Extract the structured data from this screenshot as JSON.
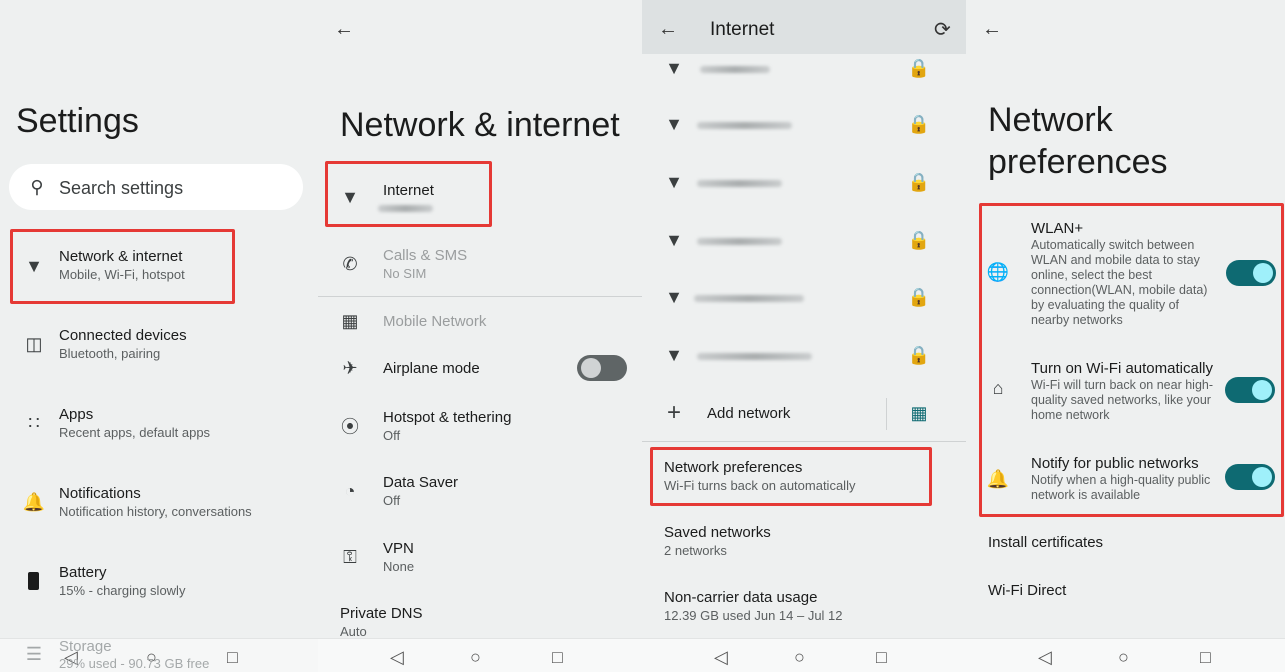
{
  "panel1": {
    "title": "Settings",
    "search_placeholder": "Search settings",
    "items": [
      {
        "label": "Network & internet",
        "sub": "Mobile, Wi-Fi, hotspot",
        "icon": "wifi-icon"
      },
      {
        "label": "Connected devices",
        "sub": "Bluetooth, pairing",
        "icon": "devices-icon"
      },
      {
        "label": "Apps",
        "sub": "Recent apps, default apps",
        "icon": "apps-grid-icon"
      },
      {
        "label": "Notifications",
        "sub": "Notification history, conversations",
        "icon": "bell-icon"
      },
      {
        "label": "Battery",
        "sub": "15% - charging slowly",
        "icon": "battery-icon"
      },
      {
        "label": "Storage",
        "sub": "29% used - 90.73 GB free",
        "icon": "storage-icon"
      }
    ]
  },
  "panel2": {
    "title": "Network & internet",
    "items": [
      {
        "label": "Internet",
        "sub": "",
        "icon": "wifi-icon"
      },
      {
        "label": "Calls & SMS",
        "sub": "No SIM",
        "icon": "calls-icon"
      },
      {
        "label": "Mobile Network",
        "sub": "",
        "icon": "sim-icon"
      },
      {
        "label": "Airplane mode",
        "sub": "",
        "icon": "airplane-icon",
        "toggle": false
      },
      {
        "label": "Hotspot & tethering",
        "sub": "Off",
        "icon": "hotspot-icon"
      },
      {
        "label": "Data Saver",
        "sub": "Off",
        "icon": "data-saver-icon"
      },
      {
        "label": "VPN",
        "sub": "None",
        "icon": "vpn-key-icon"
      },
      {
        "label": "Private DNS",
        "sub": "Auto"
      }
    ]
  },
  "panel3": {
    "title": "Internet",
    "add_network": "Add network",
    "items": [
      {
        "label": "Network preferences",
        "sub": "Wi-Fi turns back on automatically"
      },
      {
        "label": "Saved networks",
        "sub": "2 networks"
      },
      {
        "label": "Non-carrier data usage",
        "sub": "12.39 GB used Jun 14 – Jul 12"
      }
    ]
  },
  "panel4": {
    "title_line1": "Network",
    "title_line2": "preferences",
    "prefs": [
      {
        "label": "WLAN+",
        "sub": "Automatically switch between WLAN and mobile data to stay online, select the best connection(WLAN, mobile data) by evaluating the quality of nearby networks",
        "on": true,
        "icon": "globe-icon"
      },
      {
        "label": "Turn on Wi-Fi automatically",
        "sub": "Wi-Fi will turn back on near high-quality saved networks, like your home network",
        "on": true,
        "icon": "home-refresh-icon"
      },
      {
        "label": "Notify for public networks",
        "sub": "Notify when a high-quality public network is available",
        "on": true,
        "icon": "bell-wifi-icon"
      }
    ],
    "install_certificates": "Install certificates",
    "wifi_direct": "Wi-Fi Direct"
  },
  "colors": {
    "accent": "#0e6a72",
    "highlight": "#e53935"
  }
}
